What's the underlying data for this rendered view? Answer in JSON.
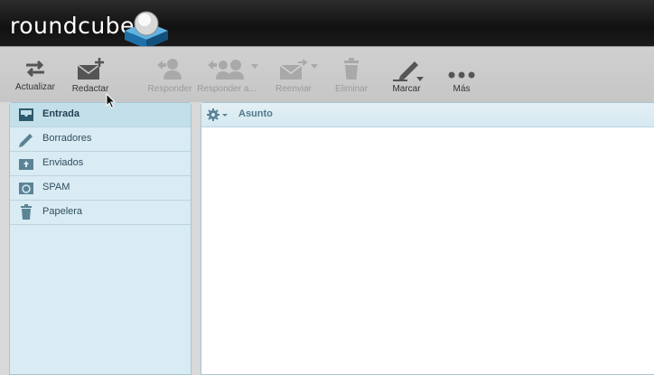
{
  "header": {
    "logo_text": "roundcube"
  },
  "toolbar": {
    "refresh_label": "Actualizar",
    "compose_label": "Redactar",
    "reply_label": "Responder",
    "reply_all_label": "Responder a...",
    "forward_label": "Reenviar",
    "delete_label": "Eliminar",
    "mark_label": "Marcar",
    "more_label": "Más"
  },
  "folders": {
    "items": [
      {
        "label": "Entrada",
        "icon": "inbox-icon",
        "active": true
      },
      {
        "label": "Borradores",
        "icon": "pencil-icon",
        "active": false
      },
      {
        "label": "Enviados",
        "icon": "sent-icon",
        "active": false
      },
      {
        "label": "SPAM",
        "icon": "recycle-icon",
        "active": false
      },
      {
        "label": "Papelera",
        "icon": "trash-icon",
        "active": false
      }
    ]
  },
  "message_list": {
    "columns": [
      "Asunto"
    ]
  },
  "colors": {
    "header_bg": "#111111",
    "accent": "#2f7fb4",
    "panel_bg": "#d9ebf3",
    "active_folder_bg": "#c3dfea"
  }
}
